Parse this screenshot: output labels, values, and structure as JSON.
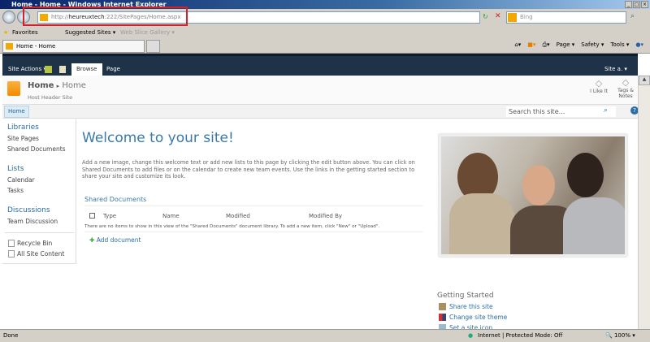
{
  "window": {
    "title": "Home - Home - Windows Internet Explorer"
  },
  "browser": {
    "url_prefix": "http://",
    "url_host": "heureuxtech",
    "url_rest": ":222/SitePages/Home.aspx",
    "search_placeholder": "Bing",
    "favorites": "Favorites",
    "suggested_sites": "Suggested Sites ▾",
    "web_slice": "Web Slice Gallery ▾",
    "tab_title": "Home - Home",
    "commands": [
      "Page ▾",
      "Safety ▾",
      "Tools ▾"
    ],
    "status": {
      "left": "Done",
      "zone": "Internet | Protected Mode: Off",
      "zoom": "100%"
    }
  },
  "ribbon": {
    "site_actions": "Site Actions ▾",
    "tabs": [
      "Browse",
      "Page"
    ],
    "user": "Site a. ▾"
  },
  "header": {
    "crumb1": "Home",
    "sep": "▸",
    "crumb2": "Home",
    "subtitle": "Host Header Site",
    "like": "I Like It",
    "tags": "Tags &",
    "notes": "Notes"
  },
  "topnav": {
    "home": "Home",
    "search_placeholder": "Search this site..."
  },
  "leftnav": {
    "libraries": "Libraries",
    "site_pages": "Site Pages",
    "shared_docs": "Shared Documents",
    "lists": "Lists",
    "calendar": "Calendar",
    "tasks": "Tasks",
    "discussions": "Discussions",
    "team_discussion": "Team Discussion",
    "recycle": "Recycle Bin",
    "all_content": "All Site Content"
  },
  "main": {
    "title": "Welcome to your site!",
    "intro": "Add a new image, change this welcome text or add new lists to this page by clicking the edit button above. You can click on Shared Documents to add files or on the calendar to create new team events. Use the links in the getting started section to share your site and customize its look.",
    "shared_docs": {
      "title": "Shared Documents",
      "columns": [
        "Type",
        "Name",
        "Modified",
        "Modified By"
      ],
      "empty": "There are no items to show in this view of the \"Shared Documents\" document library. To add a new item, click \"New\" or \"Upload\".",
      "add": "Add document"
    }
  },
  "getting_started": {
    "title": "Getting Started",
    "items": [
      "Share this site",
      "Change site theme",
      "Set a site icon"
    ]
  }
}
